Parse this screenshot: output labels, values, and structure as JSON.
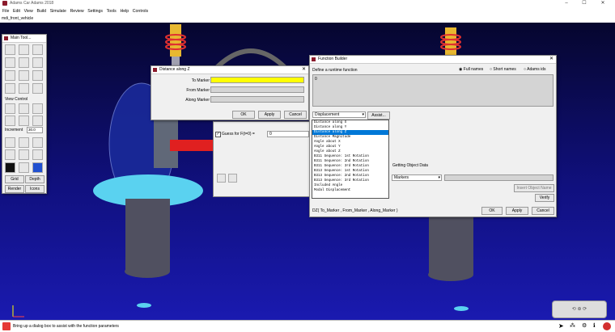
{
  "window": {
    "title": "Adams Car Adams 2018",
    "minimize": "–",
    "maximize": "☐",
    "close": "✕"
  },
  "menu": [
    "File",
    "Edit",
    "View",
    "Build",
    "Simulate",
    "Review",
    "Settings",
    "Tools",
    "Help",
    "Controls"
  ],
  "model_name": "mdi_front_vehicle",
  "main_toolbox": {
    "title": "Main Tool...",
    "view_control": "View Control",
    "increment_label": "Increment",
    "increment_value": "30.0",
    "grid": "Grid",
    "depth": "Depth",
    "render": "Render",
    "icons": "Icons"
  },
  "distance_dialog": {
    "title": "Distance along Z",
    "to_marker": "To Marker",
    "from_marker": "From Marker",
    "along_marker": "Along Marker",
    "ok": "OK",
    "apply": "Apply",
    "cancel": "Cancel"
  },
  "guess_panel": {
    "guess_label": "Guess for F(t=0) =",
    "guess_value": "0"
  },
  "function_builder": {
    "title": "Function Builder",
    "define_label": "Define a runtime function",
    "radio_full": "Full names",
    "radio_short": "Short names",
    "radio_ids": "Adams ids",
    "expression": "0",
    "category_select": "Displacement",
    "assist": "Assist...",
    "functions": [
      "Distance along X",
      "Distance along Y",
      "Distance along Z",
      "Distance Magnitude",
      "Angle about X",
      "Angle about Y",
      "Angle about Z",
      "B311 Sequence: 1st Rotation",
      "B311 Sequence: 2nd Rotation",
      "B311 Sequence: 3rd Rotation",
      "B313 Sequence: 1st Rotation",
      "B313 Sequence: 2nd Rotation",
      "B313 Sequence: 3rd Rotation",
      "Included Angle",
      "Modal Displacement"
    ],
    "selected_index": 2,
    "getting_object_data": "Getting Object Data",
    "object_type": "Markers",
    "insert_object_name": "Insert Object Name",
    "verify": "Verify",
    "signature": "DZ( To_Marker , From_Marker , Along_Marker )",
    "ok": "OK",
    "apply": "Apply",
    "cancel": "Cancel"
  },
  "status": {
    "message": "Bring up a dialog box to assist with the function parameters"
  },
  "colors": {
    "viewport_top": "#06062e",
    "viewport_bottom": "#1a1ab0",
    "highlight_field": "#ffff00",
    "selection": "#0078d7",
    "plate": "#5ad2f0"
  }
}
